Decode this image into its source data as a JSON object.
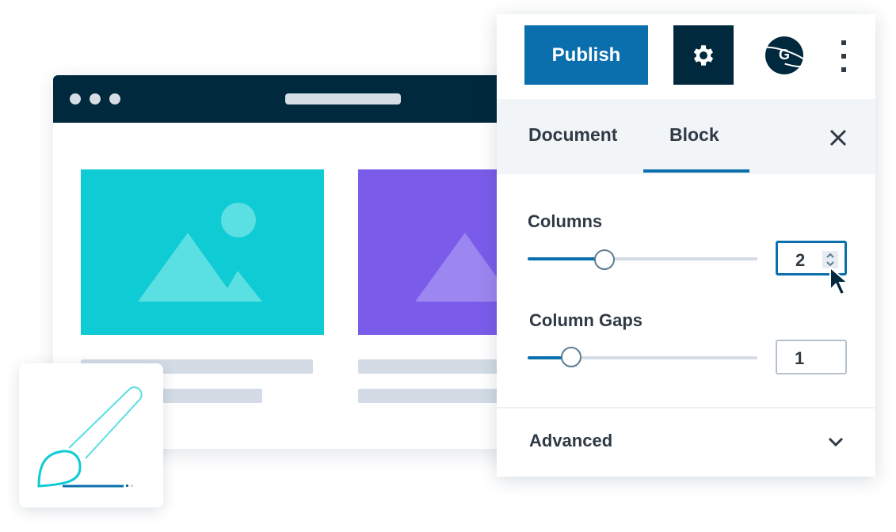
{
  "toolbar": {
    "publish_label": "Publish",
    "settings_icon": "gear-icon",
    "avatar_letter": "G",
    "more_icon": "vertical-ellipsis-icon"
  },
  "tabs": {
    "document": "Document",
    "block": "Block",
    "close_icon": "close-icon"
  },
  "columns": {
    "label": "Columns",
    "value": "2",
    "slider_value": 2
  },
  "column_gaps": {
    "label": "Column Gaps",
    "value": "1",
    "slider_value": 1
  },
  "advanced": {
    "label": "Advanced",
    "icon": "chevron-down-icon"
  },
  "colors": {
    "accent": "#0a6fac",
    "dark": "#00293d",
    "teal": "#0ecbd4",
    "purple": "#7b5cea"
  }
}
